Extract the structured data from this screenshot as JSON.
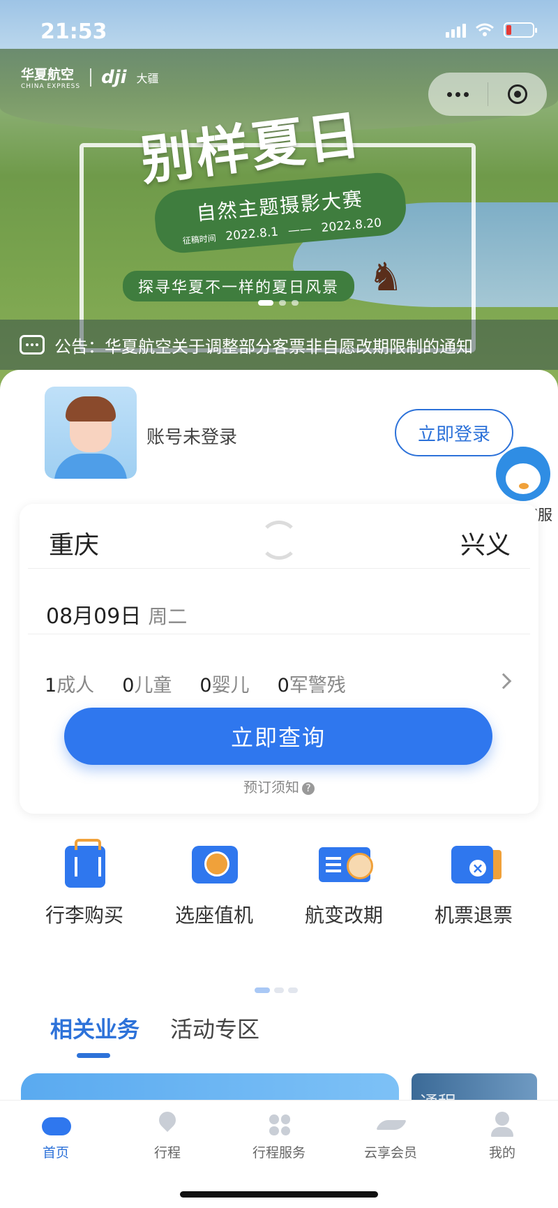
{
  "status_bar": {
    "time": "21:53",
    "battery_level": 0.2
  },
  "banner": {
    "brand_name": "华夏航空",
    "brand_sub": "CHINA EXPRESS",
    "partner_name": "大疆",
    "partner_logo": "dji",
    "headline": "别样夏日",
    "contest_title": "自然主题摄影大赛",
    "period_label": "征稿时间",
    "period_start": "2022.8.1",
    "period_sep": "——",
    "period_end": "2022.8.20",
    "subline": "探寻华夏不一样的夏日风景",
    "slide_count": 3,
    "active_slide": 1
  },
  "notice": {
    "icon": "chat-bubble-icon",
    "text": "公告：华夏航空关于调整部分客票非自愿改期限制的通知"
  },
  "user": {
    "status": "账号未登录",
    "login_label": "立即登录"
  },
  "customer_service": {
    "label": "在线客服"
  },
  "search": {
    "from_city": "重庆",
    "to_city": "兴义",
    "date": "08月09日",
    "weekday": "周二",
    "passengers": [
      {
        "count": "1",
        "type": "成人"
      },
      {
        "count": "0",
        "type": "儿童"
      },
      {
        "count": "0",
        "type": "婴儿"
      },
      {
        "count": "0",
        "type": "军警残"
      }
    ],
    "submit_label": "立即查询",
    "booking_notice": "预订须知",
    "help_mark": "?"
  },
  "quick_actions": [
    {
      "label": "行李购买",
      "icon": "luggage-icon"
    },
    {
      "label": "选座值机",
      "icon": "seat-icon"
    },
    {
      "label": "航变改期",
      "icon": "ticket-change-icon"
    },
    {
      "label": "机票退票",
      "icon": "ticket-refund-icon"
    }
  ],
  "tabs": [
    {
      "label": "相关业务",
      "active": true
    },
    {
      "label": "活动专区",
      "active": false
    }
  ],
  "promo": {
    "side_text": "通程"
  },
  "bottom_nav": [
    {
      "label": "首页",
      "icon": "home-cloud-icon",
      "active": true
    },
    {
      "label": "行程",
      "icon": "location-pin-icon",
      "active": false
    },
    {
      "label": "行程服务",
      "icon": "grid-icon",
      "active": false
    },
    {
      "label": "云享会员",
      "icon": "member-wing-icon",
      "active": false
    },
    {
      "label": "我的",
      "icon": "user-icon",
      "active": false
    }
  ],
  "colors": {
    "primary": "#2f77ee",
    "accent": "#f0a13a",
    "banner_green": "#3f7d3e"
  }
}
